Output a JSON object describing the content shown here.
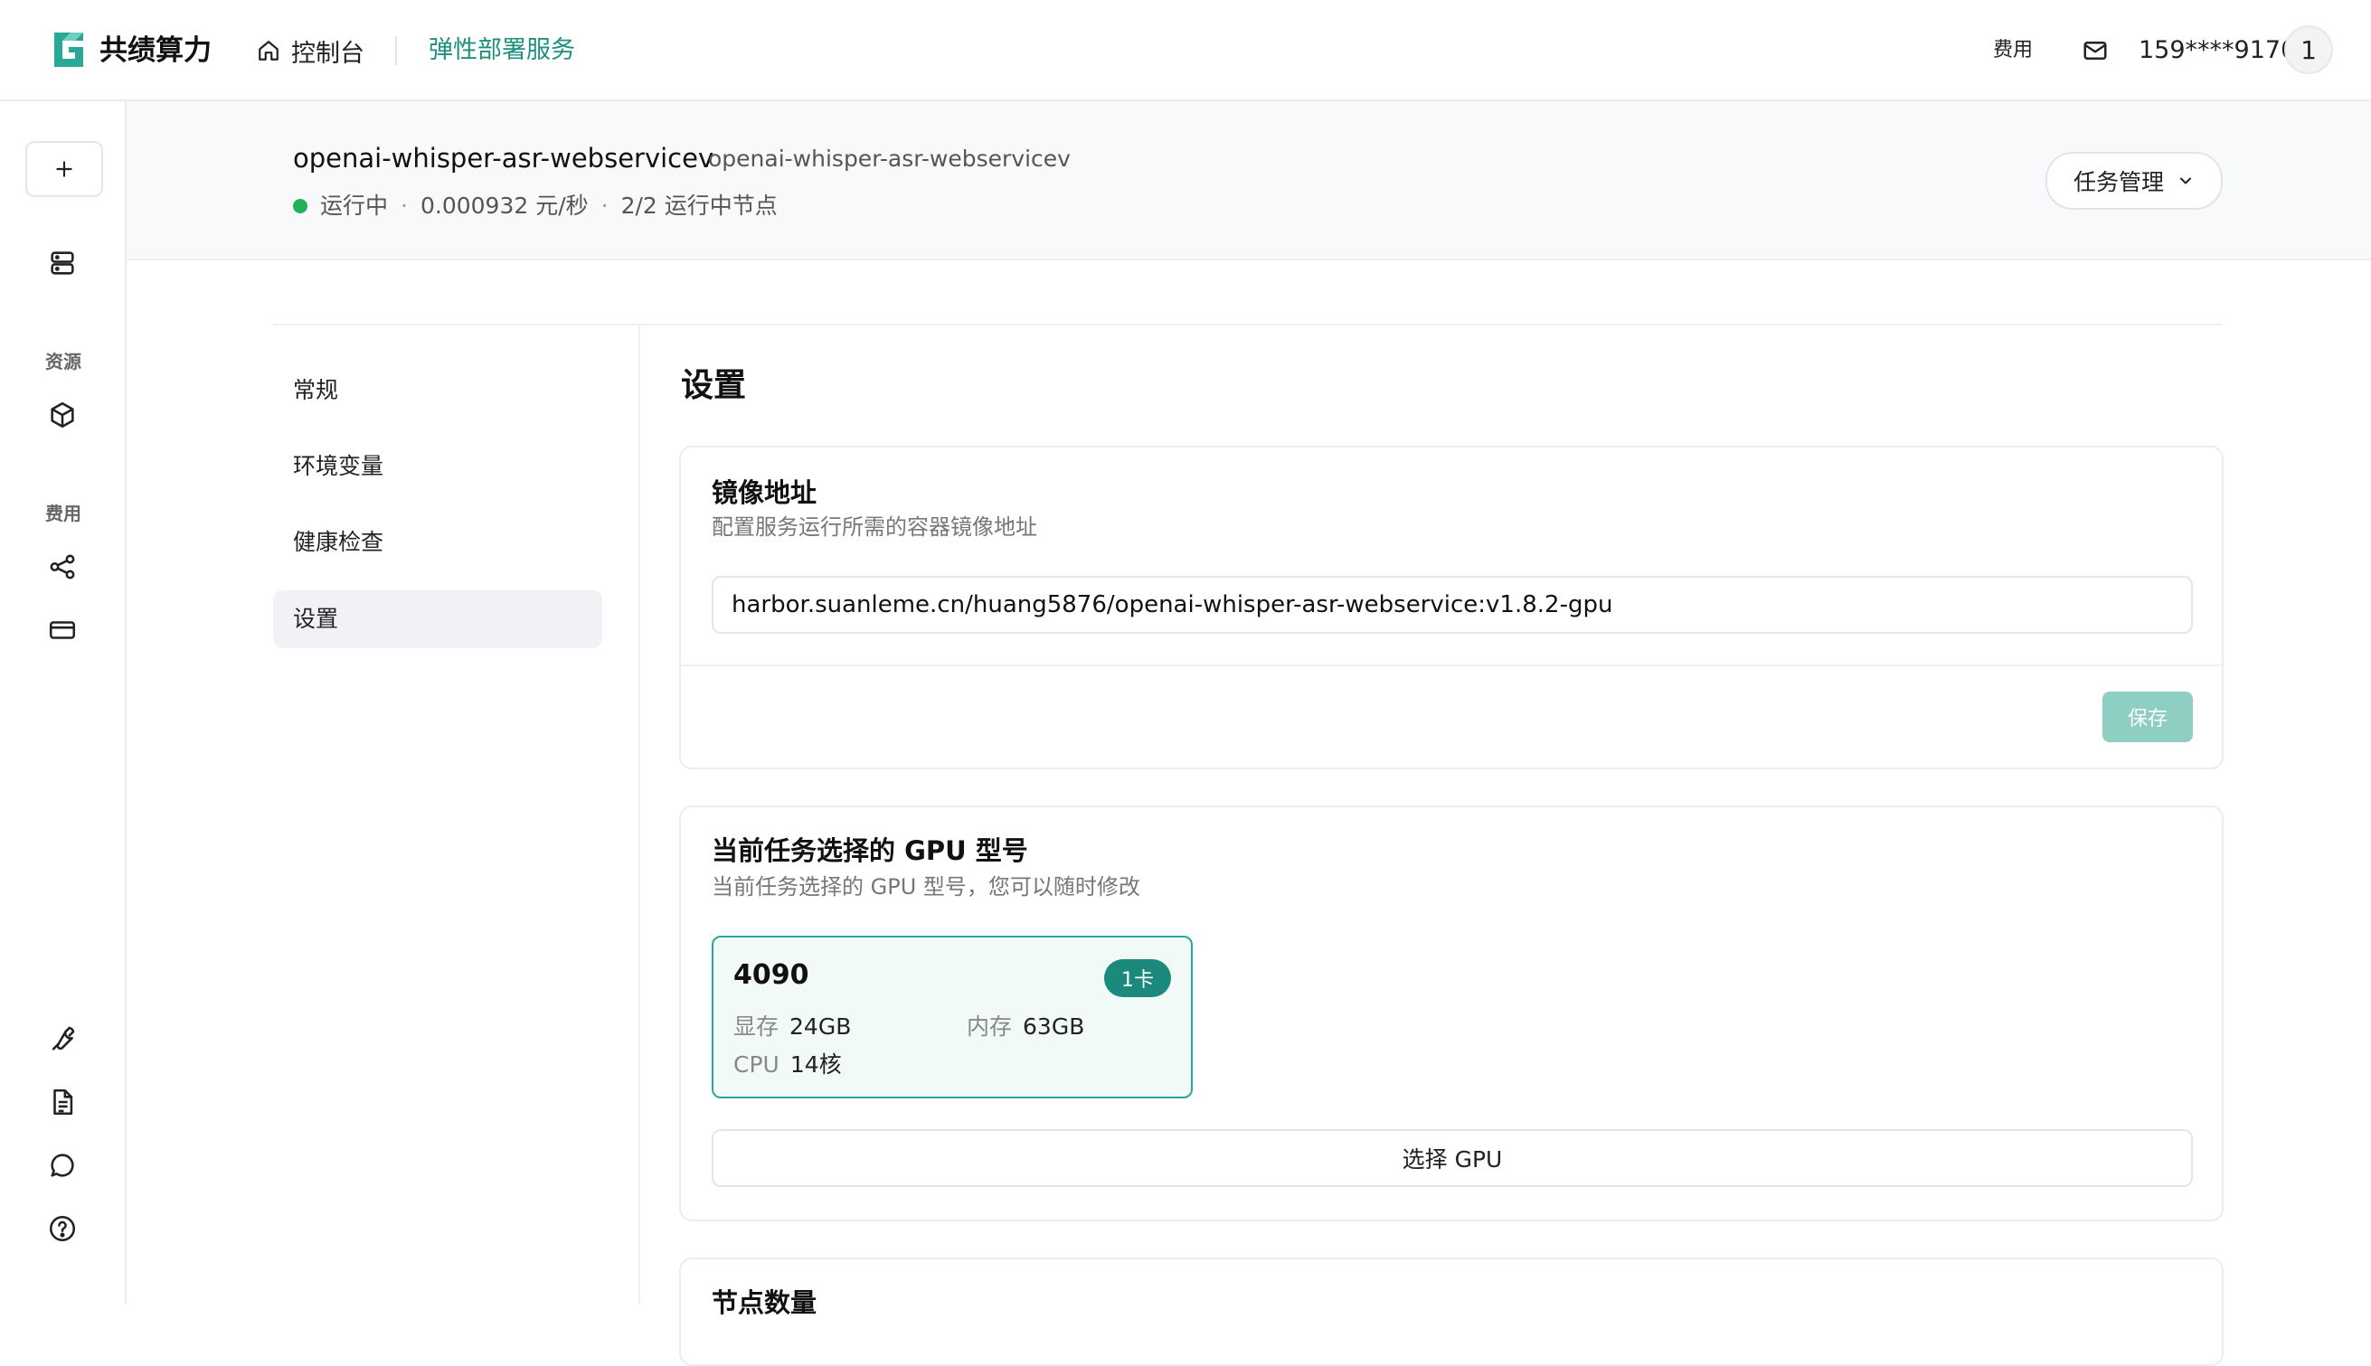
{
  "topbar": {
    "brand": "共绩算力",
    "console_label": "控制台",
    "elastic_label": "弹性部署服务",
    "fee_label": "费用",
    "phone": "159****9170",
    "avatar_text": "1",
    "accent_color": "#1f8f7f"
  },
  "rail": {
    "resources_label": "资源",
    "fees_label": "费用",
    "icons": [
      "plus-icon",
      "server-icon",
      "cube-icon",
      "share-icon",
      "card-icon",
      "wrench-icon",
      "document-icon",
      "chat-icon",
      "help-icon"
    ]
  },
  "service": {
    "name": "openai-whisper-asr-webservicev",
    "subtitle": "openai-whisper-asr-webservicev",
    "status": "运行中",
    "price": "0.000932 元/秒",
    "nodes": "2/2 运行中节点",
    "status_color": "#22b05a",
    "task_button": "任务管理"
  },
  "sidenav": {
    "items": [
      {
        "label": "常规"
      },
      {
        "label": "环境变量"
      },
      {
        "label": "健康检查"
      },
      {
        "label": "设置"
      }
    ],
    "active": "设置"
  },
  "settings": {
    "title": "设置",
    "image": {
      "title": "镜像地址",
      "desc": "配置服务运行所需的容器镜像地址",
      "value": "harbor.suanleme.cn/huang5876/openai-whisper-asr-webservice:v1.8.2-gpu",
      "save_label": "保存"
    },
    "gpu": {
      "title": "当前任务选择的 GPU 型号",
      "desc": "当前任务选择的 GPU 型号，您可以随时修改",
      "model": "4090",
      "badge": "1卡",
      "vram_label": "显存",
      "vram": "24GB",
      "mem_label": "内存",
      "mem": "63GB",
      "cpu_label": "CPU",
      "cpu": "14核",
      "select_label": "选择 GPU"
    },
    "nodes": {
      "title": "节点数量"
    }
  }
}
